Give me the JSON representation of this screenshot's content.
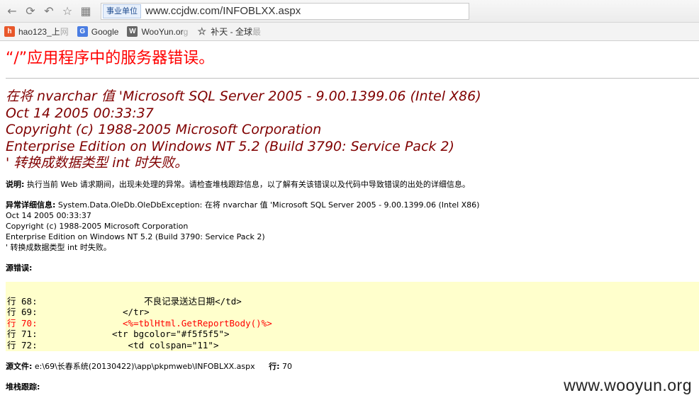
{
  "browser": {
    "cert_badge": "事业单位",
    "url": "www.ccjdw.com/INFOBLXX.aspx",
    "bookmarks": [
      {
        "label": "hao123_上",
        "fade": "网",
        "icon": "hao"
      },
      {
        "label": "Google",
        "fade": "",
        "icon": "G"
      },
      {
        "label": "WooYun.or",
        "fade": "g",
        "icon": "W"
      },
      {
        "label": "补天 - 全球",
        "fade": "最",
        "icon": "☆"
      }
    ]
  },
  "page": {
    "title": "“/”应用程序中的服务器错误。",
    "error_heading": [
      "在将 nvarchar 值 'Microsoft SQL Server 2005 - 9.00.1399.06 (Intel X86)",
      "Oct 14 2005 00:33:37",
      "Copyright (c) 1988-2005 Microsoft Corporation",
      "Enterprise Edition on Windows NT 5.2 (Build 3790: Service Pack 2)",
      "' 转换成数据类型 int 时失败。"
    ],
    "description_label": "说明:",
    "description_text": " 执行当前 Web 请求期间，出现未处理的异常。请检查堆栈跟踪信息，以了解有关该错误以及代码中导致错误的出处的详细信息。",
    "exception_label": "异常详细信息:",
    "exception_lines": [
      " System.Data.OleDb.OleDbException: 在将 nvarchar 值 'Microsoft SQL Server 2005 - 9.00.1399.06 (Intel X86)",
      "Oct 14 2005 00:33:37",
      "Copyright (c) 1988-2005 Microsoft Corporation",
      "Enterprise Edition on Windows NT 5.2 (Build 3790: Service Pack 2)",
      "' 转换成数据类型 int 时失败。"
    ],
    "source_error_label": "源错误:",
    "code_lines": [
      {
        "text": "行 68:                    不良记录送达日期</td>",
        "highlight": false
      },
      {
        "text": "行 69:                </tr>",
        "highlight": false
      },
      {
        "text": "行 70:                <%=tblHtml.GetReportBody()%>",
        "highlight": true
      },
      {
        "text": "行 71:              <tr bgcolor=\"#f5f5f5\">",
        "highlight": false
      },
      {
        "text": "行 72:                 <td colspan=\"11\">",
        "highlight": false
      }
    ],
    "source_file_label": "源文件:",
    "source_file_path": " e:\\69\\长春系统(20130422)\\app\\pkpmweb\\INFOBLXX.aspx",
    "line_label": "行:",
    "line_number": " 70",
    "stack_trace_label": "堆栈跟踪:"
  },
  "watermark": "www.wooyun.org",
  "colors": {
    "title": "#ff0000",
    "error_heading": "#800000",
    "code_background": "#ffffcc",
    "highlight": "#ff0000"
  }
}
